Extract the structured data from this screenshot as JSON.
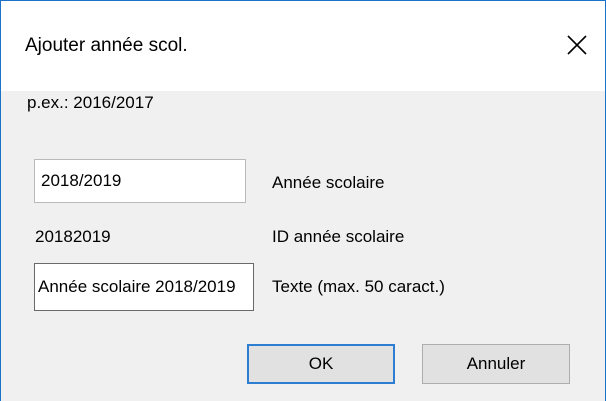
{
  "dialog": {
    "title": "Ajouter année scol.",
    "hint": "p.ex.: 2016/2017"
  },
  "form": {
    "year_value": "2018/2019",
    "year_label": "Année scolaire",
    "id_value": "20182019",
    "id_label": "ID année scolaire",
    "text_value": "Année scolaire 2018/2019",
    "text_label": "Texte (max. 50 caract.)"
  },
  "buttons": {
    "ok_label": "OK",
    "cancel_label": "Annuler"
  },
  "icons": {
    "close": "close-icon"
  },
  "colors": {
    "window_border": "#1a73c9",
    "default_button_border": "#2d7dd2"
  }
}
